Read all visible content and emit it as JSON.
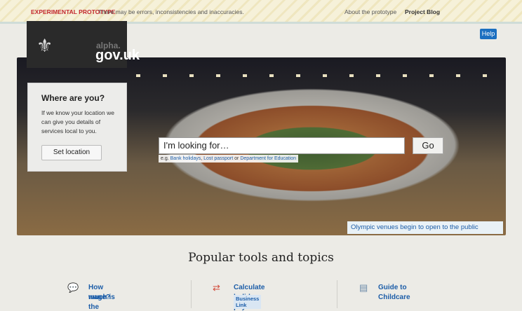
{
  "banner": {
    "warning_strong": "EXPERIMENTAL PROTOTYPE",
    "warning_text": "There may be errors, inconsistencies and inaccuracies.",
    "about_link": "About the prototype",
    "blog_link": "Project Blog"
  },
  "help_button": "Help",
  "logo": {
    "alpha": "alpha.",
    "site": "gov.uk"
  },
  "location_box": {
    "title": "Where are you?",
    "description": "If we know your location we can give you details of services local to you.",
    "button": "Set location"
  },
  "search": {
    "placeholder": "I'm looking for…",
    "go_button": "Go",
    "hint_prefix": "e.g.",
    "hint_link_1": "Bank holidays",
    "hint_sep_1": ",",
    "hint_link_2": "Lost passport",
    "hint_sep_2": "or",
    "hint_link_3": "Department for Education"
  },
  "hero_caption": "Olympic venues begin to open to the public",
  "popular": {
    "title": "Popular tools and topics",
    "items": [
      {
        "label_1": "How much is the minimum",
        "label_2": "wage?"
      },
      {
        "label_1": "Calculate holiday pay",
        "badge": "Business Link"
      },
      {
        "label_1": "Guide to Childcare"
      }
    ]
  },
  "colors": {
    "link": "#1c5da8",
    "warning": "#c2272d",
    "help_bg": "#1c6fc0"
  }
}
